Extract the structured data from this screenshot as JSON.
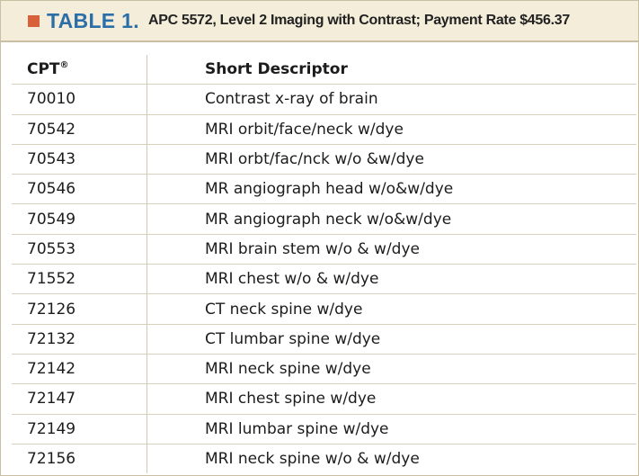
{
  "title": {
    "label": "TABLE 1.",
    "text": "APC 5572, Level 2 Imaging with Contrast; Payment Rate $456.37"
  },
  "colors": {
    "accent_square": "#d9613a",
    "title_label": "#2b6ea8",
    "title_bg": "#f3edd9",
    "border": "#c9bfa4"
  },
  "table": {
    "headers": {
      "code": "CPT",
      "code_mark": "®",
      "descriptor": "Short Descriptor"
    },
    "rows": [
      {
        "code": "70010",
        "descriptor": "Contrast x-ray of brain"
      },
      {
        "code": "70542",
        "descriptor": "MRI orbit/face/neck w/dye"
      },
      {
        "code": "70543",
        "descriptor": "MRI orbt/fac/nck w/o &w/dye"
      },
      {
        "code": "70546",
        "descriptor": "MR angiograph head w/o&w/dye"
      },
      {
        "code": "70549",
        "descriptor": "MR angiograph neck w/o&w/dye"
      },
      {
        "code": "70553",
        "descriptor": "MRI brain stem w/o & w/dye"
      },
      {
        "code": "71552",
        "descriptor": "MRI chest w/o & w/dye"
      },
      {
        "code": "72126",
        "descriptor": "CT neck spine w/dye"
      },
      {
        "code": "72132",
        "descriptor": "CT lumbar spine w/dye"
      },
      {
        "code": "72142",
        "descriptor": "MRI neck spine w/dye"
      },
      {
        "code": "72147",
        "descriptor": "MRI chest spine w/dye"
      },
      {
        "code": "72149",
        "descriptor": "MRI lumbar spine w/dye"
      },
      {
        "code": "72156",
        "descriptor": "MRI neck spine w/o & w/dye"
      }
    ]
  }
}
